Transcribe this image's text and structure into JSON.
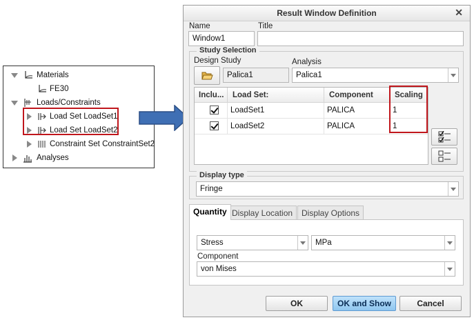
{
  "tree": {
    "items": [
      {
        "label": "Materials"
      },
      {
        "label": "FE30"
      },
      {
        "label": "Loads/Constraints"
      },
      {
        "label": "Load Set LoadSet1"
      },
      {
        "label": "Load Set LoadSet2"
      },
      {
        "label": "Constraint Set ConstraintSet2"
      },
      {
        "label": "Analyses"
      }
    ]
  },
  "dialog": {
    "title": "Result Window Definition",
    "close_glyph": "✕",
    "name_label": "Name",
    "name_value": "Window1",
    "title_label": "Title",
    "title_value": "",
    "study_selection": {
      "group_title": "Study Selection",
      "design_study_label": "Design Study",
      "design_study_value": "Palica1",
      "analysis_label": "Analysis",
      "analysis_value": "Palica1"
    },
    "table": {
      "headers": [
        "Inclu...",
        "Load Set:",
        "Component",
        "Scaling"
      ],
      "rows": [
        {
          "included": true,
          "load_set": "LoadSet1",
          "component": "PALICA",
          "scaling": "1"
        },
        {
          "included": true,
          "load_set": "LoadSet2",
          "component": "PALICA",
          "scaling": "1"
        }
      ]
    },
    "display_type": {
      "group_title": "Display type",
      "value": "Fringe"
    },
    "tabs": [
      {
        "label": "Quantity",
        "active": true
      },
      {
        "label": "Display Location",
        "active": false
      },
      {
        "label": "Display Options",
        "active": false
      }
    ],
    "quantity": {
      "quantity_value": "Stress",
      "units_value": "MPa",
      "component_label": "Component",
      "component_value": "von Mises"
    },
    "buttons": {
      "ok": "OK",
      "ok_and_show": "OK and Show",
      "cancel": "Cancel"
    }
  },
  "colors": {
    "highlight": "#c0161c",
    "arrow": "#3f6fb4",
    "primary_button": "#8fc6ef"
  }
}
